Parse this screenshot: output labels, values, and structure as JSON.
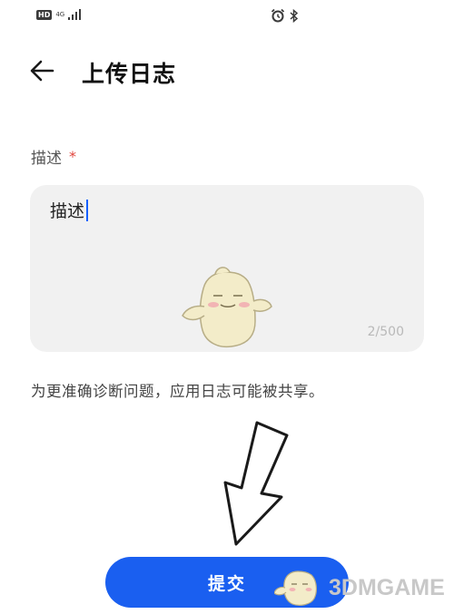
{
  "status_bar": {
    "hd_label": "HD",
    "network_label": "4G",
    "icons": [
      "signal-icon",
      "alarm-icon",
      "bluetooth-icon"
    ]
  },
  "header": {
    "back_icon": "back-arrow-icon",
    "title": "上传日志"
  },
  "form": {
    "description_label": "描述",
    "required_mark": "*",
    "description_value": "描述",
    "char_count": "2/500"
  },
  "hint": "为更准确诊断问题，应用日志可能被共享。",
  "submit_label": "提交",
  "watermark": "3DMGAME",
  "colors": {
    "accent": "#1a5ff0",
    "required": "#e0443c",
    "input_bg": "#f1f1f1",
    "caret": "#1560ff"
  }
}
